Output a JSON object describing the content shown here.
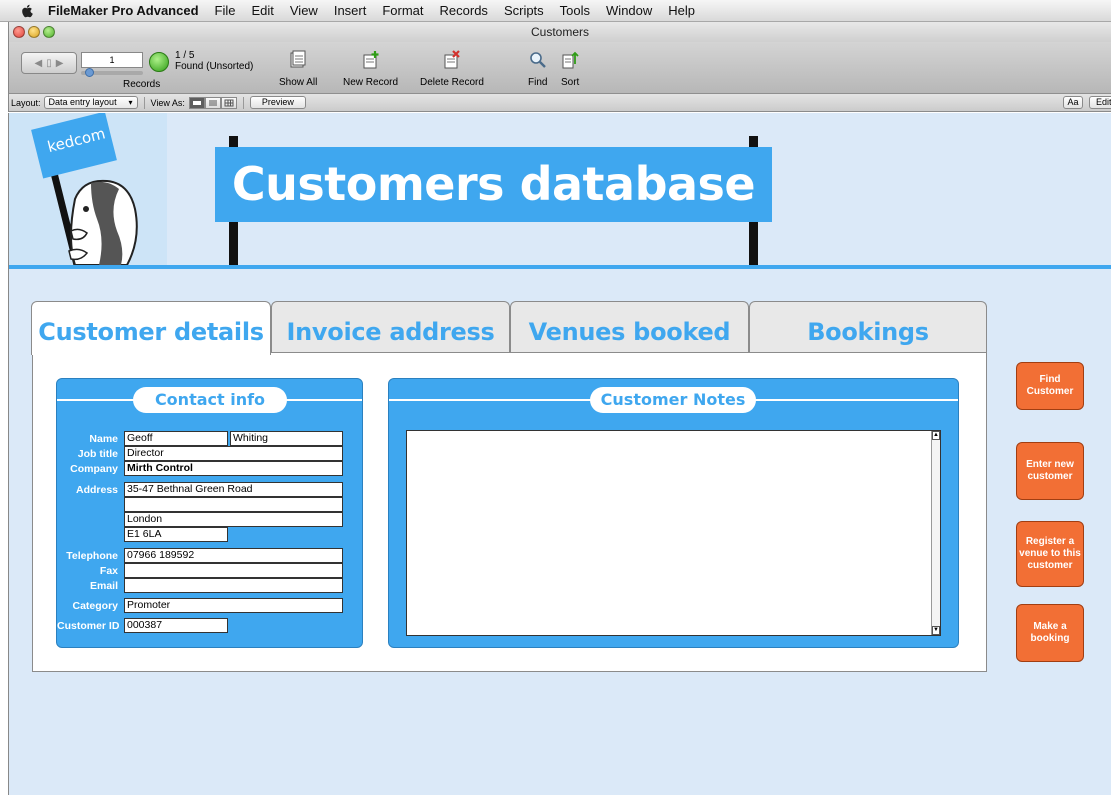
{
  "menubar": {
    "app_name": "FileMaker Pro Advanced",
    "items": [
      "File",
      "Edit",
      "View",
      "Insert",
      "Format",
      "Records",
      "Scripts",
      "Tools",
      "Window",
      "Help"
    ]
  },
  "window": {
    "title": "Customers"
  },
  "toolbar": {
    "record_number": "1",
    "found_count": "1 / 5",
    "found_status": "Found (Unsorted)",
    "records_label": "Records",
    "show_all_label": "Show All",
    "new_record_label": "New Record",
    "delete_record_label": "Delete Record",
    "find_label": "Find",
    "sort_label": "Sort"
  },
  "layoutbar": {
    "layout_label": "Layout:",
    "layout_value": "Data entry layout",
    "view_as_label": "View As:",
    "preview_label": "Preview",
    "font_label": "Aa",
    "edit_label": "Edit"
  },
  "header": {
    "logo_text": "kedcom",
    "banner_title": "Customers database"
  },
  "tabs": [
    {
      "label": "Customer details",
      "active": true
    },
    {
      "label": "Invoice address",
      "active": false
    },
    {
      "label": "Venues booked",
      "active": false
    },
    {
      "label": "Bookings",
      "active": false
    }
  ],
  "contact": {
    "heading": "Contact info",
    "labels": {
      "name": "Name",
      "job_title": "Job title",
      "company": "Company",
      "address": "Address",
      "telephone": "Telephone",
      "fax": "Fax",
      "email": "Email",
      "category": "Category",
      "customer_id": "Customer ID"
    },
    "values": {
      "first_name": "Geoff",
      "last_name": "Whiting",
      "job_title": "Director",
      "company": "Mirth Control",
      "address_1": "35-47 Bethnal Green Road",
      "address_2": "",
      "address_3": "London",
      "postcode": "E1 6LA",
      "telephone": "07966 189592",
      "fax": "",
      "email": "",
      "category": "Promoter",
      "customer_id": "000387"
    }
  },
  "notes": {
    "heading": "Customer Notes",
    "value": ""
  },
  "actions": {
    "find_customer": "Find Customer",
    "enter_new_customer": "Enter new customer",
    "register_venue": "Register a venue to this customer",
    "make_booking": "Make a booking"
  },
  "colors": {
    "accent_blue": "#3fa7ef",
    "background": "#dbe9f8",
    "action_orange": "#f26f35"
  }
}
